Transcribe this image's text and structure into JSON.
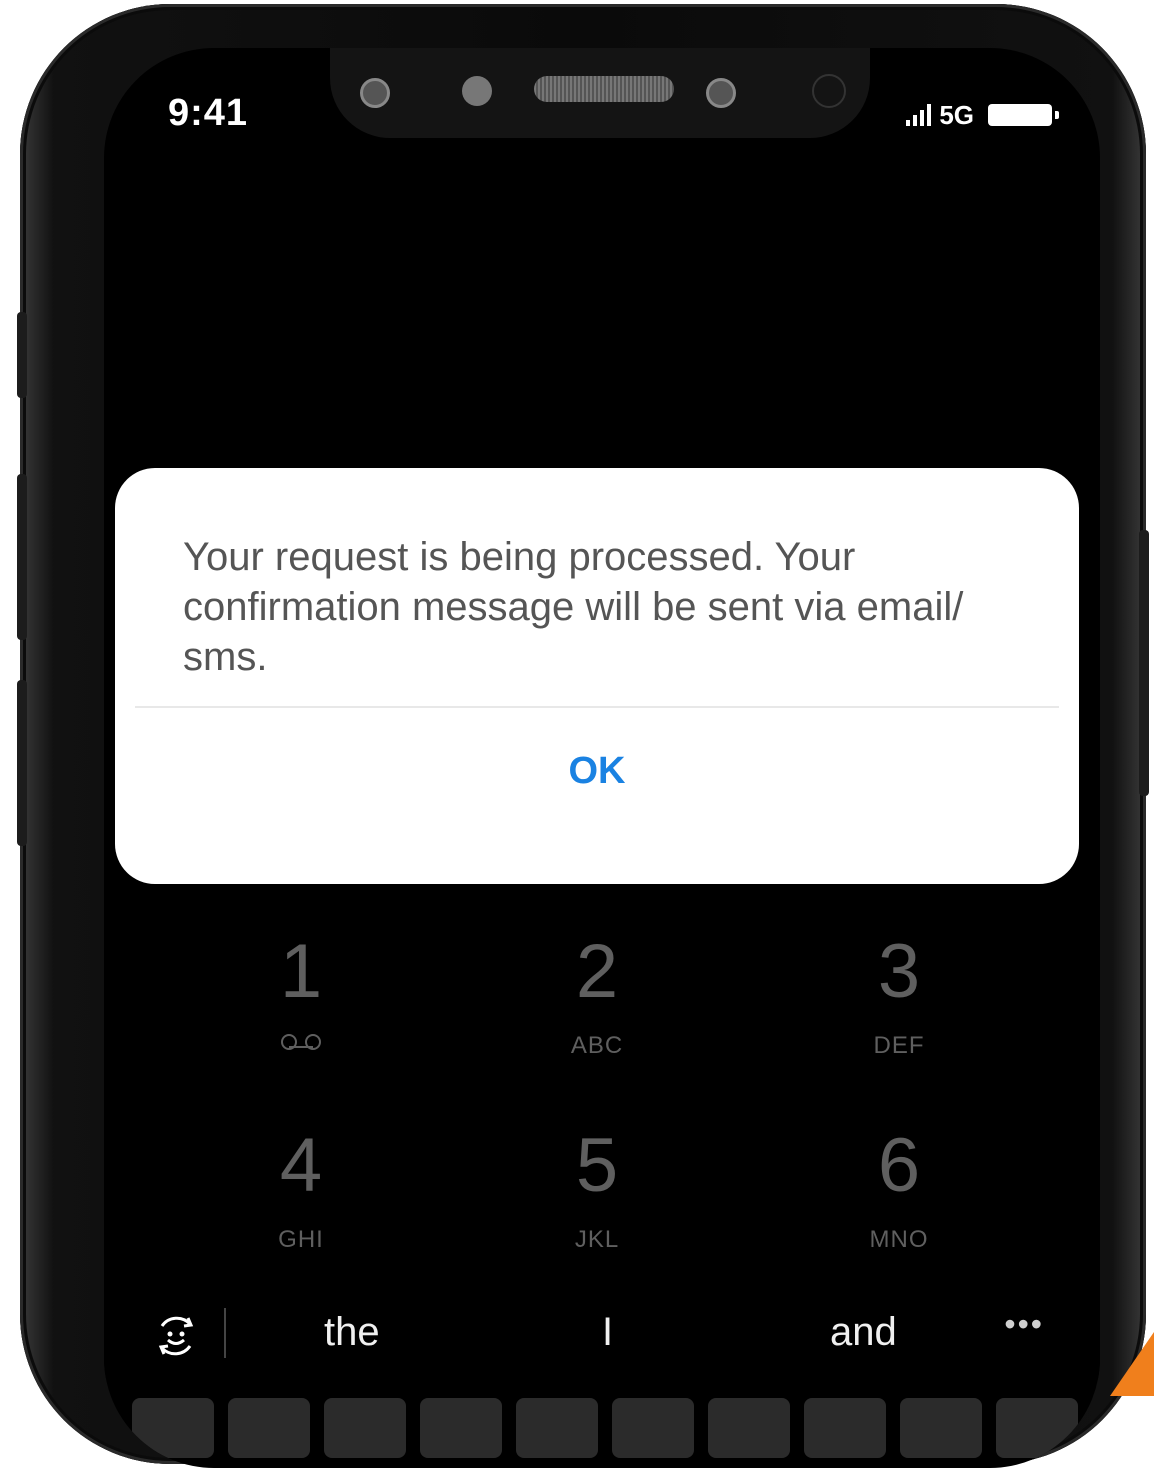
{
  "status_bar": {
    "time": "9:41",
    "network": "5G",
    "signal_icon": "signal-bars-icon",
    "battery_icon": "battery-icon"
  },
  "dialpad": {
    "keys": [
      {
        "digit": "1",
        "letters": "",
        "icon": "voicemail-icon"
      },
      {
        "digit": "2",
        "letters": "ABC"
      },
      {
        "digit": "3",
        "letters": "DEF"
      },
      {
        "digit": "4",
        "letters": "GHI"
      },
      {
        "digit": "5",
        "letters": "JKL"
      },
      {
        "digit": "6",
        "letters": "MNO"
      }
    ]
  },
  "dialog": {
    "message": "Your request is being processed. Your confirmation message will be sent via email/ sms.",
    "ok_label": "OK"
  },
  "keyboard": {
    "suggestions": [
      "the",
      "I",
      "and"
    ],
    "emoji_toggle_icon": "emoji-switch-icon",
    "more_icon": "ellipsis-icon",
    "more_label": "•••"
  },
  "colors": {
    "accent": "#1a82e2",
    "brand_corner": "#f07f1c",
    "dialog_bg": "#ffffff",
    "message_text": "#555555"
  }
}
